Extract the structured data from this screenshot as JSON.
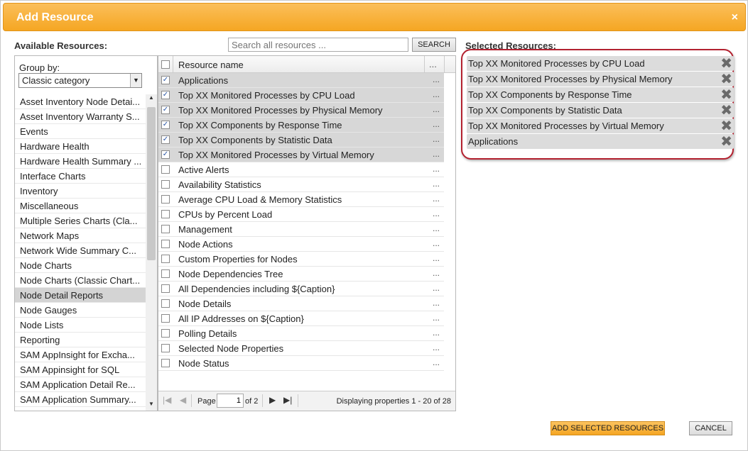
{
  "dialog": {
    "title": "Add Resource",
    "close": "×"
  },
  "available": {
    "label": "Available Resources:",
    "search_placeholder": "Search all resources ...",
    "search_button": "SEARCH",
    "groupby_label": "Group by:",
    "groupby_value": "Classic category",
    "categories": [
      "Asset Inventory Node Detai...",
      "Asset Inventory Warranty S...",
      "Events",
      "Hardware Health",
      "Hardware Health Summary ...",
      "Interface Charts",
      "Inventory",
      "Miscellaneous",
      "Multiple Series Charts (Cla...",
      "Network Maps",
      "Network Wide Summary C...",
      "Node Charts",
      "Node Charts (Classic Chart...",
      "Node Detail Reports",
      "Node Gauges",
      "Node Lists",
      "Reporting",
      "SAM AppInsight for Excha...",
      "SAM Appinsight for SQL",
      "SAM Application Detail Re...",
      "SAM Application Summary..."
    ],
    "selected_category": "Node Detail Reports"
  },
  "grid": {
    "col_name": "Resource name",
    "col_more": "...",
    "rows": [
      {
        "name": "Applications",
        "checked": true
      },
      {
        "name": "Top XX Monitored Processes by CPU Load",
        "checked": true
      },
      {
        "name": "Top XX Monitored Processes by Physical Memory",
        "checked": true
      },
      {
        "name": "Top XX Components by Response Time",
        "checked": true
      },
      {
        "name": "Top XX Components by Statistic Data",
        "checked": true
      },
      {
        "name": "Top XX Monitored Processes by Virtual Memory",
        "checked": true
      },
      {
        "name": "Active Alerts",
        "checked": false
      },
      {
        "name": "Availability Statistics",
        "checked": false
      },
      {
        "name": "Average CPU Load & Memory Statistics",
        "checked": false
      },
      {
        "name": "CPUs by Percent Load",
        "checked": false
      },
      {
        "name": "Management",
        "checked": false
      },
      {
        "name": "Node Actions",
        "checked": false
      },
      {
        "name": "Custom Properties for Nodes",
        "checked": false
      },
      {
        "name": "Node Dependencies Tree",
        "checked": false
      },
      {
        "name": "All Dependencies including ${Caption}",
        "checked": false
      },
      {
        "name": "Node Details",
        "checked": false
      },
      {
        "name": "All IP Addresses on ${Caption}",
        "checked": false
      },
      {
        "name": "Polling Details",
        "checked": false
      },
      {
        "name": "Selected Node Properties",
        "checked": false
      },
      {
        "name": "Node Status",
        "checked": false
      }
    ],
    "pager": {
      "page_label": "Page",
      "page_value": "1",
      "of_label": "of 2",
      "display_text": "Displaying properties 1 - 20 of 28"
    }
  },
  "selected": {
    "label": "Selected Resources:",
    "items": [
      "Top XX Monitored Processes by CPU Load",
      "Top XX Monitored Processes by Physical Memory",
      "Top XX Components by Response Time",
      "Top XX Components by Statistic Data",
      "Top XX Monitored Processes by Virtual Memory",
      "Applications"
    ]
  },
  "footer": {
    "add_button": "ADD SELECTED RESOURCES",
    "cancel_button": "CANCEL"
  },
  "colors": {
    "title_orange": "#f5a623",
    "highlight_red": "#b3212f",
    "check_blue": "#2a55a5"
  }
}
